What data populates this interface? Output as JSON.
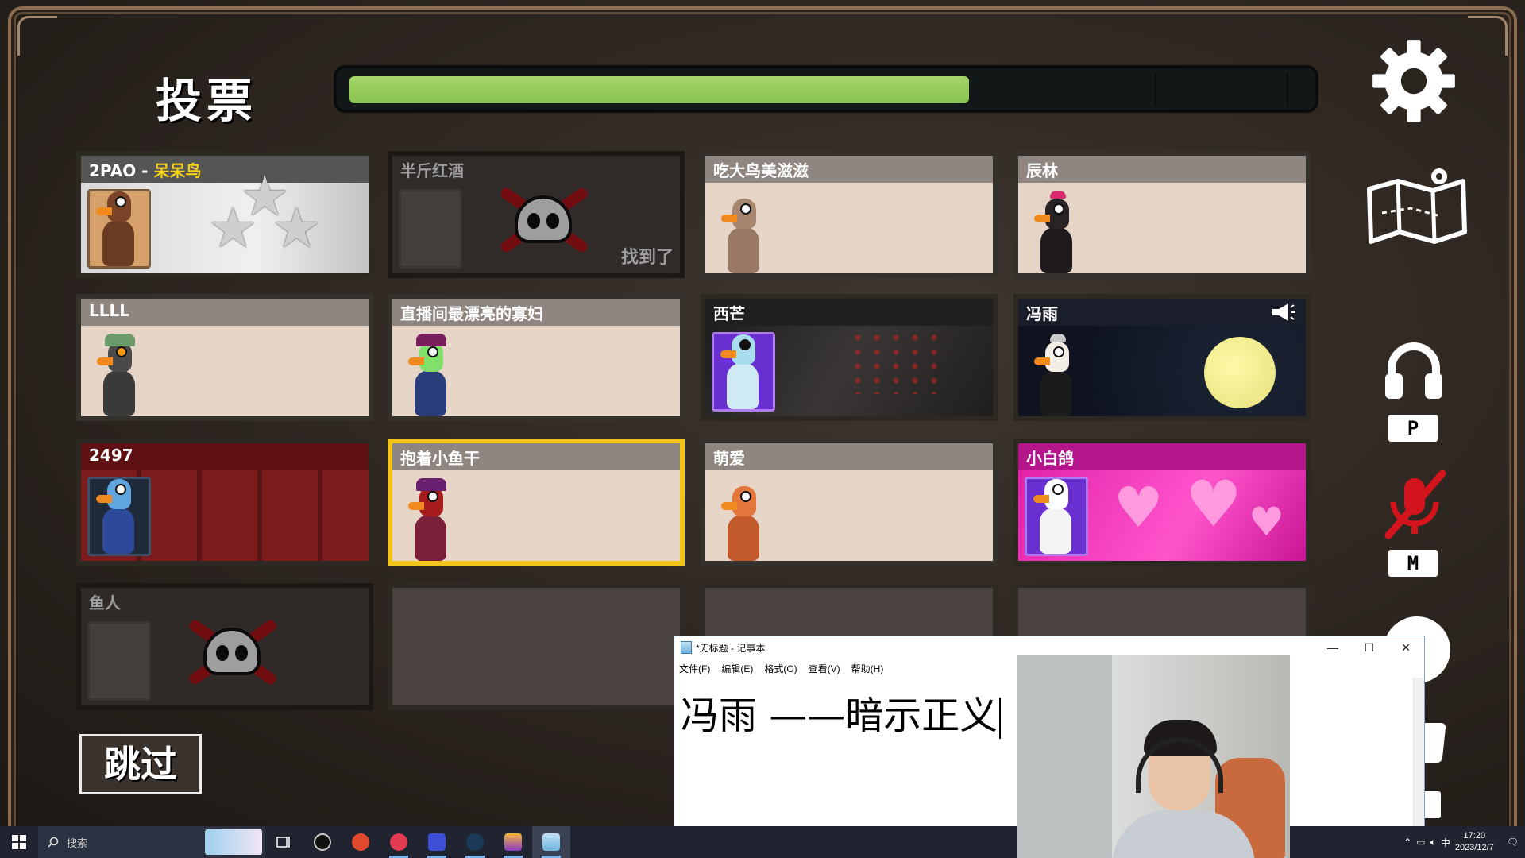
{
  "title": "投票",
  "timer": {
    "progress": 0.65
  },
  "players": [
    {
      "name_prefix": "2PAO - ",
      "name_suffix": "呆呆鸟",
      "style": "star",
      "status": "alive"
    },
    {
      "name": "半斤红酒",
      "style": "dead",
      "status": "found",
      "found_label": "找到了"
    },
    {
      "name": "吃大鸟美滋滋",
      "style": "plain",
      "status": "alive"
    },
    {
      "name": "辰林",
      "style": "plain",
      "status": "alive"
    },
    {
      "name": "LLLL",
      "style": "plain",
      "status": "alive"
    },
    {
      "name": "直播间最漂亮的寡妇",
      "style": "plain",
      "status": "alive"
    },
    {
      "name": "西芒",
      "style": "dark",
      "status": "alive"
    },
    {
      "name": "冯雨",
      "style": "night",
      "status": "alive",
      "speaking": true
    },
    {
      "name": "2497",
      "style": "red",
      "status": "alive"
    },
    {
      "name": "抱着小鱼干",
      "style": "plain",
      "status": "alive",
      "selected": true
    },
    {
      "name": "萌爱",
      "style": "plain",
      "status": "alive"
    },
    {
      "name": "小白鸽",
      "style": "pink",
      "status": "alive"
    },
    {
      "name": "鱼人",
      "style": "fish",
      "status": "dead"
    }
  ],
  "skip_button": "跳过",
  "hud": {
    "settings_icon": "gear-icon",
    "map_icon": "map-icon",
    "push_to_talk_key": "P",
    "mute_key": "M",
    "mic_state": "muted"
  },
  "notepad": {
    "title": "*无标题 - 记事本",
    "menu": [
      "文件(F)",
      "编辑(E)",
      "格式(O)",
      "查看(V)",
      "帮助(H)"
    ],
    "content": "冯雨 ——暗示正义"
  },
  "taskbar": {
    "search_placeholder": "搜索",
    "time": "17:20",
    "date": "2023/12/7",
    "ime": "中"
  }
}
